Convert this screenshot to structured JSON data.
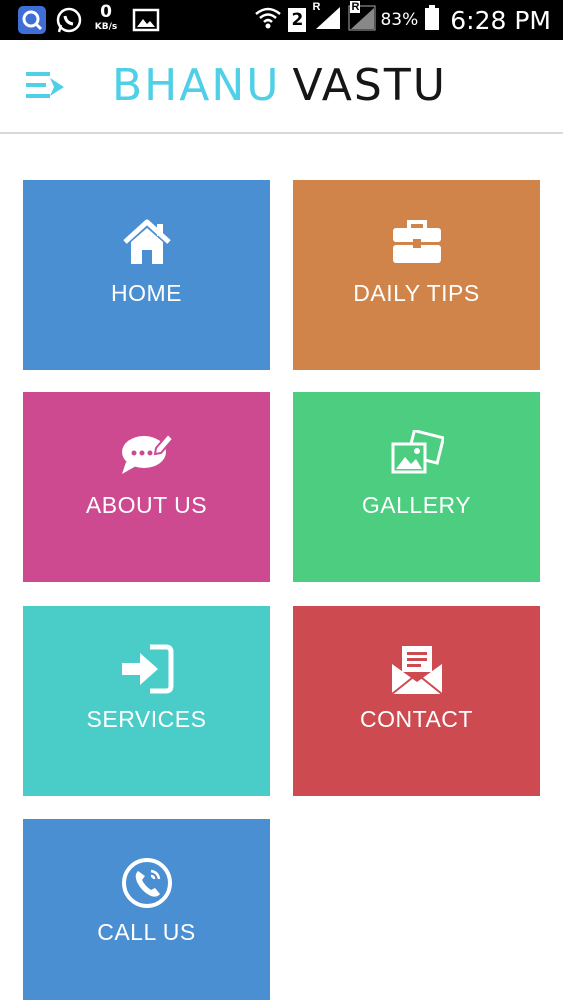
{
  "status_bar": {
    "net_speed_value": "0",
    "net_speed_unit": "KB/s",
    "sim_slot": "2",
    "roaming_indicator": "R",
    "roaming_indicator_2": "R",
    "battery_percent": "83%",
    "time": "6:28 PM",
    "icons": [
      "search-app-icon",
      "whatsapp-icon",
      "image-icon",
      "wifi-icon",
      "signal-icon",
      "battery-icon"
    ]
  },
  "header": {
    "brand_part1": "BHANU",
    "brand_part2": "VASTU",
    "menu_icon": "menu-icon"
  },
  "tiles": [
    {
      "label": "HOME",
      "icon": "home-icon",
      "color": "#4a8fd1"
    },
    {
      "label": "DAILY TIPS",
      "icon": "briefcase-icon",
      "color": "#d0844a"
    },
    {
      "label": "ABOUT US",
      "icon": "chat-bubble-icon",
      "color": "#cd4a91"
    },
    {
      "label": "GALLERY",
      "icon": "pictures-icon",
      "color": "#4ccd80"
    },
    {
      "label": "SERVICES",
      "icon": "sign-in-icon",
      "color": "#4acdc8"
    },
    {
      "label": "CONTACT",
      "icon": "envelope-icon",
      "color": "#cd4a51"
    },
    {
      "label": "CALL US",
      "icon": "phone-icon",
      "color": "#4a8fd1"
    }
  ],
  "colors": {
    "brand_accent": "#4fd0e6",
    "brand_dark": "#161616",
    "status_bar_bg": "#000000"
  }
}
